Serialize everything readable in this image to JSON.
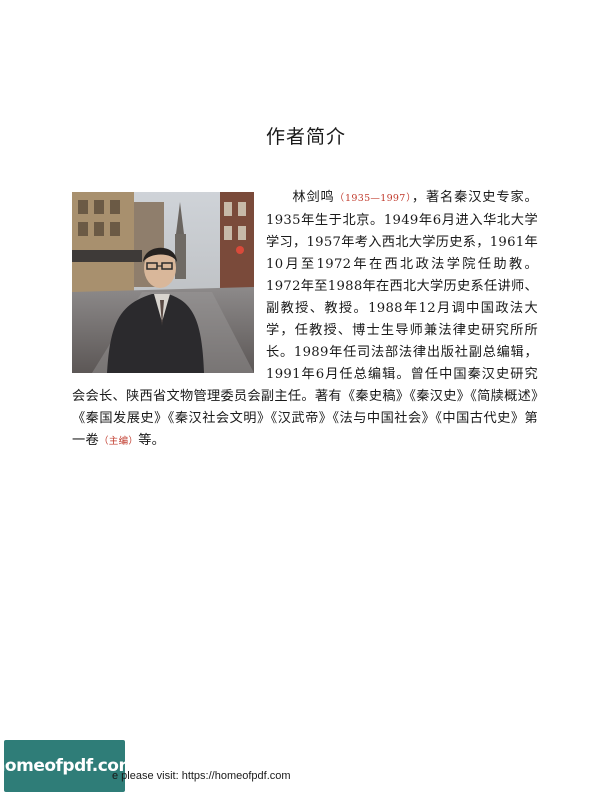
{
  "page": {
    "title": "作者简介"
  },
  "bio": {
    "lead_name": "林剑鸣",
    "lifespan": "（1935—1997）",
    "text_1": "，著名秦汉史专家。1935年生于北京。1949年6月进入华北大学学习，1957年考入西北大学历史系，1961年10月至1972年在西北政法学院任助教。1972年至1988年在西北大学历史系任讲师、副教授、教授。1988年12月调中国政法大学，任教授、博士生导师兼法律史研究所所长。1989年任司法部法律出版社副总编辑，1991年6月任总编辑。曾任中国秦汉史研究会会长、陕西省文物管理委员会副主任。著有《秦史稿》《秦汉史》《简牍概述》《秦国发展史》《秦汉社会文明》《汉武帝》《法与中国社会》《中国古代史》第一卷",
    "editor_note": "（主编）",
    "text_2": "等。"
  },
  "footer": {
    "logo_text": "homeofpdf.com",
    "visit_text": "e please visit: https://homeofpdf.com"
  },
  "colors": {
    "note": "#c0392b",
    "footer_bar": "#2f7d78"
  },
  "icons": {
    "portrait": "author-portrait-photo"
  }
}
